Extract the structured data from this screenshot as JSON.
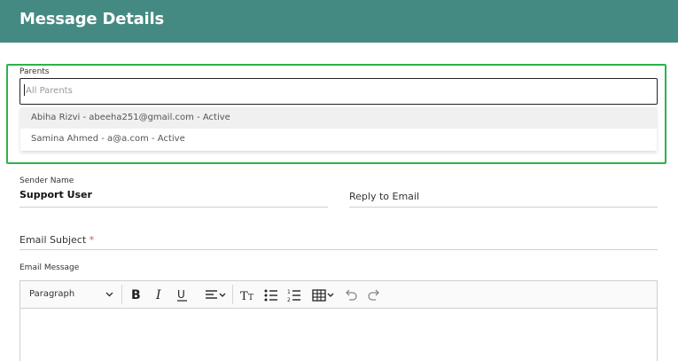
{
  "header": {
    "title": "Message Details"
  },
  "parents": {
    "label": "Parents",
    "placeholder": "All Parents",
    "options": [
      "Abiha Rizvi - abeeha251@gmail.com - Active",
      "Samina Ahmed - a@a.com - Active"
    ]
  },
  "sender": {
    "label": "Sender Name",
    "value": "Support User"
  },
  "reply": {
    "label": "Reply to Email"
  },
  "subject": {
    "label": "Email Subject",
    "required_mark": "*"
  },
  "message": {
    "label": "Email Message",
    "toolbar": {
      "paragraph_label": "Paragraph",
      "icons": [
        "chevron-down-icon",
        "bold-icon",
        "italic-icon",
        "underline-icon",
        "align-icon",
        "text-size-icon",
        "bulleted-list-icon",
        "numbered-list-icon",
        "table-icon",
        "undo-icon",
        "redo-icon"
      ]
    }
  },
  "colors": {
    "header": "#458a82",
    "highlight": "#2bb34a",
    "required": "#d9534f"
  }
}
